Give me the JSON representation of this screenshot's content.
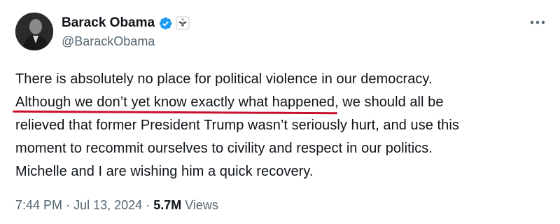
{
  "author": {
    "display_name": "Barack Obama",
    "handle": "@BarackObama",
    "verified": true,
    "avatar_icon": "profile-photo",
    "affiliation_icon": "government-seal-icon"
  },
  "tweet": {
    "lines": [
      "There is absolutely no place for political violence in our democracy.",
      "Although we don’t yet know exactly what happened",
      ", we should all be",
      "relieved that former President Trump wasn’t seriously hurt, and use this",
      "moment to recommit ourselves to civility and respect in our politics.",
      "Michelle and I are wishing him a quick recovery."
    ]
  },
  "meta": {
    "time": "7:44 PM",
    "separator": "·",
    "date": "Jul 13, 2024",
    "views_count": "5.7M",
    "views_label": "Views"
  },
  "colors": {
    "text": "#0f1419",
    "secondary": "#536471",
    "verified_blue": "#1d9bf0",
    "underline_red": "#c8102e"
  }
}
